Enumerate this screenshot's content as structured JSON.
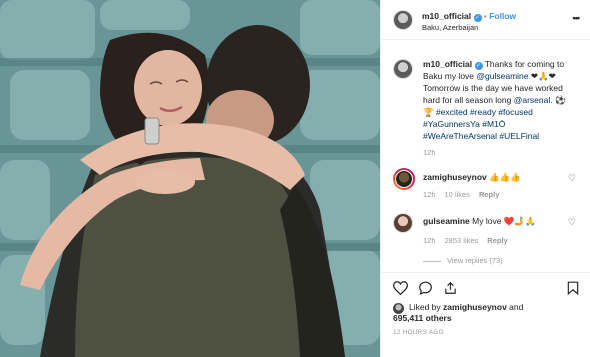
{
  "post": {
    "username": "m10_official",
    "follow_label": "Follow",
    "location": "Baku, Azerbaijan",
    "more_label": "•••"
  },
  "caption": {
    "username": "m10_official",
    "text_line1": "Thanks for coming to",
    "text_line2_pre": "Baku my love ",
    "mention1": "@gulseamine",
    "emoji1": "❤🙏❤",
    "text_line3": "Tomorrow is the day we have worked",
    "text_line4_pre": "hard for all season long ",
    "mention2": "@arsenal",
    "emoji2": ". ⚽",
    "tag_line5": "🏆 #excited #ready #focused",
    "tag_line6": "#YaGunnersYa #M1Ö",
    "tag_line7": "#WeAreTheArsenal #UELFinal",
    "time": "12h"
  },
  "comments": [
    {
      "username": "zamighuseynov",
      "text": "👍👍👍",
      "time": "12h",
      "likes": "10 likes",
      "reply": "Reply"
    },
    {
      "username": "gulseamine",
      "text": "My love ❤️🤳🙏",
      "time": "12h",
      "likes": "2853 likes",
      "reply": "Reply",
      "view_replies": "View replies (73)"
    }
  ],
  "actions": {
    "like_icon": "heart-icon",
    "comment_icon": "comment-icon",
    "share_icon": "share-icon",
    "save_icon": "bookmark-icon"
  },
  "liked_by": {
    "prefix": "Liked by ",
    "user": "zamighuseynov",
    "and": " and",
    "count": "695,411 others"
  },
  "timestamp": "12 HOURS AGO",
  "colors": {
    "accent": "#3897f0",
    "link": "#003569",
    "heart_red": "#ed4956"
  }
}
